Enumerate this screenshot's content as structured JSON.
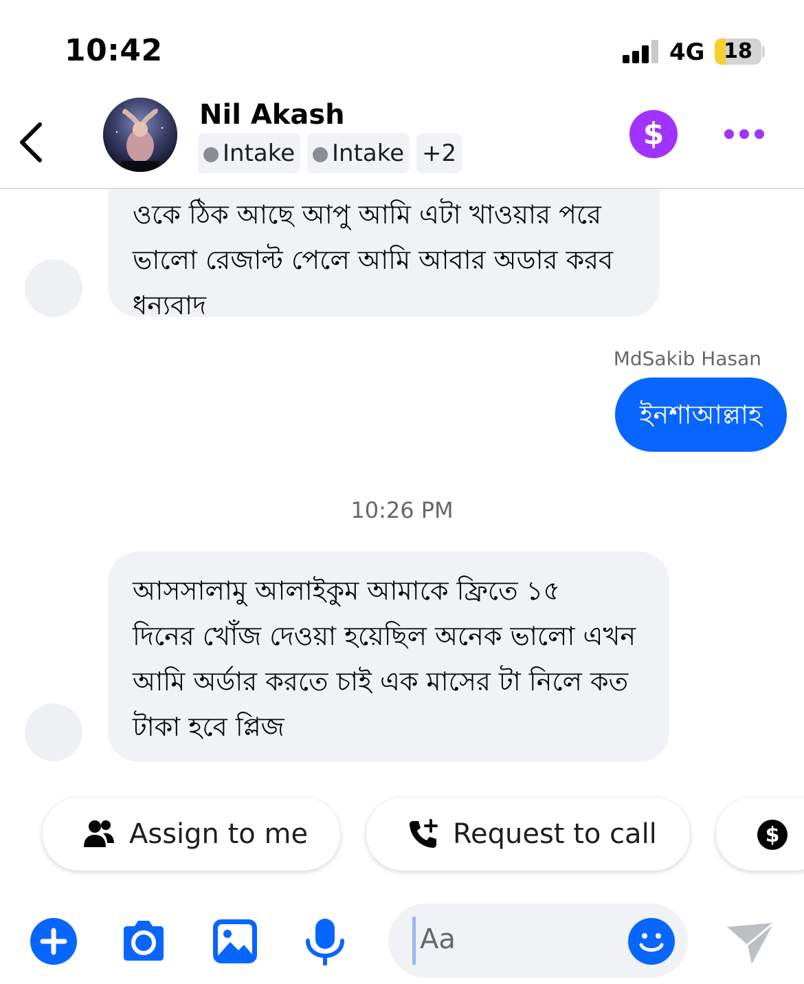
{
  "status_bar": {
    "time": "10:42",
    "network": "4G",
    "battery": "18"
  },
  "header": {
    "contact_name": "Nil Akash",
    "labels": [
      "Intake",
      "Intake"
    ],
    "more_labels": "+2",
    "payment_symbol": "$"
  },
  "messages": [
    {
      "direction": "incoming",
      "lines": [
        "ওকে ঠিক আছে আপু আমি এটা খাওয়ার পরে",
        "ভালো রেজাল্ট পেলে আমি আবার অডার করব",
        "ধন্যবাদ"
      ]
    },
    {
      "direction": "outgoing",
      "sender": "MdSakib Hasan",
      "text": "ইনশাআল্লাহ"
    },
    {
      "direction": "incoming",
      "timestamp": "10:26 PM",
      "lines": [
        "আসসালামু আলাইকুম আমাকে ফ্রিতে ১৫",
        "দিনের খোঁজ দেওয়া হয়েছিল অনেক ভালো এখন",
        "আমি অর্ডার করতে চাই এক মাসের টা নিলে কত",
        "টাকা হবে প্লিজ"
      ]
    }
  ],
  "quick_actions": {
    "assign": "Assign to me",
    "call": "Request to call"
  },
  "composer": {
    "placeholder": "Aa"
  },
  "colors": {
    "accent": "#0866ff",
    "payment": "#a033ff",
    "bubble_in": "#f0f2f5"
  }
}
